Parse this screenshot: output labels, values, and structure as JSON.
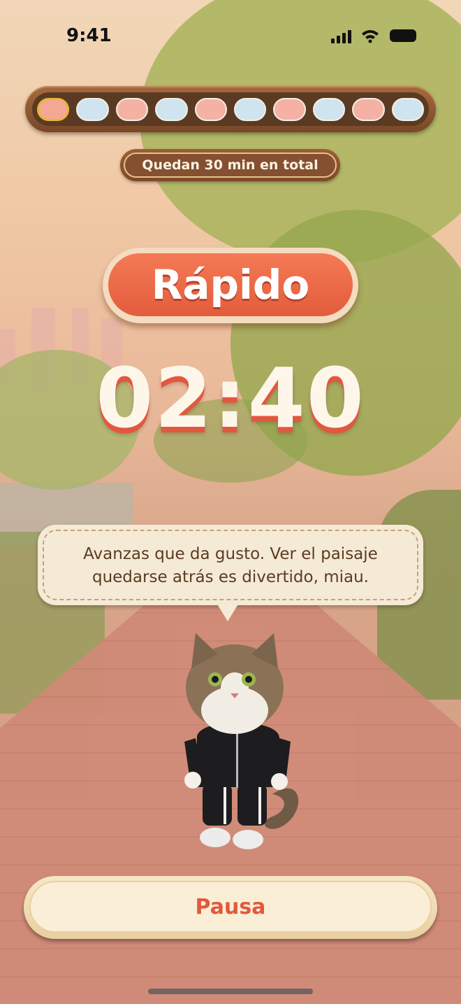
{
  "status_bar": {
    "time": "9:41"
  },
  "progress": {
    "segments": [
      "fast",
      "slow",
      "fast",
      "slow",
      "fast",
      "slow",
      "fast",
      "slow",
      "fast",
      "slow"
    ],
    "current_index": 0,
    "remaining_text": "Quedan 30 min en total"
  },
  "mode": {
    "label": "Rápido"
  },
  "timer": {
    "display": "02:40"
  },
  "bubble": {
    "line1": "Avanzas que da gusto. Ver el paisaje",
    "line2": "quedarse atrás es divertido, miau."
  },
  "pause_button": {
    "label": "Pausa"
  },
  "colors": {
    "accent": "#e35c3c",
    "fast_segment": "#f5b2a4",
    "slow_segment": "#cfe4ef",
    "wood": "#7a4727"
  }
}
